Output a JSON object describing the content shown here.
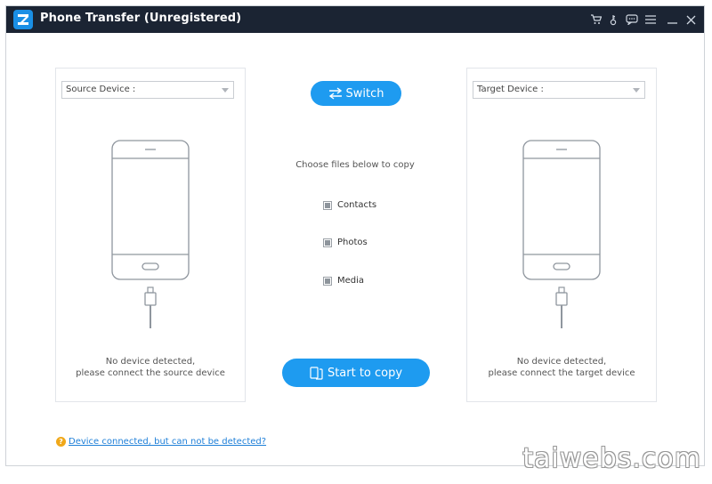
{
  "window": {
    "title": "Phone Transfer (Unregistered)"
  },
  "titlebar_icons": [
    "cart-icon",
    "key-icon",
    "feedback-icon",
    "menu-icon",
    "minimize-icon",
    "close-icon"
  ],
  "source": {
    "select_label": "Source Device :",
    "status_line1": "No device detected,",
    "status_line2": "please connect the source device"
  },
  "target": {
    "select_label": "Target Device :",
    "status_line1": "No device detected,",
    "status_line2": "please connect the target device"
  },
  "center": {
    "switch_label": "Switch",
    "choose_text": "Choose files below to copy",
    "file_options": [
      "Contacts",
      "Photos",
      "Media"
    ],
    "start_label": "Start to copy"
  },
  "footer": {
    "help_link": "Device connected, but can not be detected?"
  },
  "watermark": "taiwebs.com",
  "colors": {
    "titlebar": "#1b2433",
    "accent": "#1e9bf0",
    "help_icon": "#f0a81a"
  }
}
